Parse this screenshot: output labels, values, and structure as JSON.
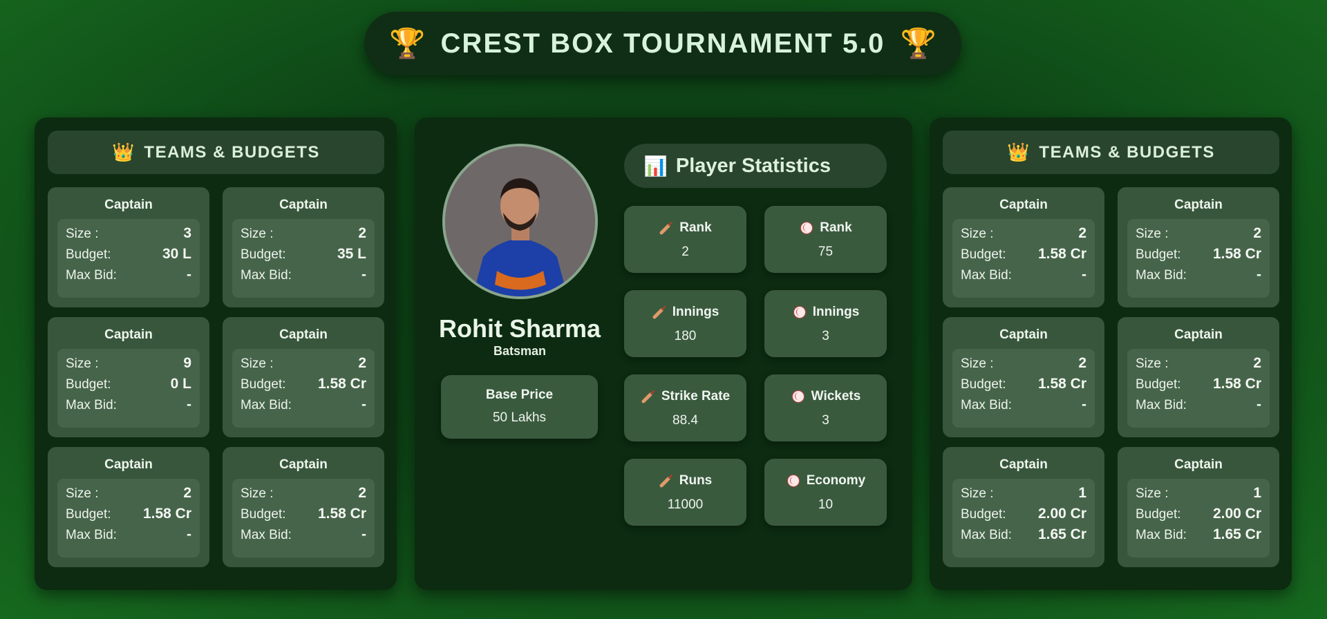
{
  "header": {
    "title": "CREST BOX TOURNAMENT 5.0",
    "icon_left": "🏆",
    "icon_right": "🏆"
  },
  "left_panel": {
    "title": "TEAMS & BUDGETS",
    "icon": "👑",
    "teams": [
      {
        "name": "Captain",
        "size_label": "Size :",
        "size": "3",
        "budget_label": "Budget:",
        "budget": "30 L",
        "maxbid_label": "Max Bid:",
        "maxbid": "-"
      },
      {
        "name": "Captain",
        "size_label": "Size :",
        "size": "2",
        "budget_label": "Budget:",
        "budget": "35 L",
        "maxbid_label": "Max Bid:",
        "maxbid": "-"
      },
      {
        "name": "Captain",
        "size_label": "Size :",
        "size": "9",
        "budget_label": "Budget:",
        "budget": "0 L",
        "maxbid_label": "Max Bid:",
        "maxbid": "-"
      },
      {
        "name": "Captain",
        "size_label": "Size :",
        "size": "2",
        "budget_label": "Budget:",
        "budget": "1.58 Cr",
        "maxbid_label": "Max Bid:",
        "maxbid": "-"
      },
      {
        "name": "Captain",
        "size_label": "Size :",
        "size": "2",
        "budget_label": "Budget:",
        "budget": "1.58 Cr",
        "maxbid_label": "Max Bid:",
        "maxbid": "-"
      },
      {
        "name": "Captain",
        "size_label": "Size :",
        "size": "2",
        "budget_label": "Budget:",
        "budget": "1.58 Cr",
        "maxbid_label": "Max Bid:",
        "maxbid": "-"
      }
    ]
  },
  "right_panel": {
    "title": "TEAMS & BUDGETS",
    "icon": "👑",
    "teams": [
      {
        "name": "Captain",
        "size_label": "Size :",
        "size": "2",
        "budget_label": "Budget:",
        "budget": "1.58 Cr",
        "maxbid_label": "Max Bid:",
        "maxbid": "-"
      },
      {
        "name": "Captain",
        "size_label": "Size :",
        "size": "2",
        "budget_label": "Budget:",
        "budget": "1.58 Cr",
        "maxbid_label": "Max Bid:",
        "maxbid": "-"
      },
      {
        "name": "Captain",
        "size_label": "Size :",
        "size": "2",
        "budget_label": "Budget:",
        "budget": "1.58 Cr",
        "maxbid_label": "Max Bid:",
        "maxbid": "-"
      },
      {
        "name": "Captain",
        "size_label": "Size :",
        "size": "2",
        "budget_label": "Budget:",
        "budget": "1.58 Cr",
        "maxbid_label": "Max Bid:",
        "maxbid": "-"
      },
      {
        "name": "Captain",
        "size_label": "Size :",
        "size": "1",
        "budget_label": "Budget:",
        "budget": "2.00 Cr",
        "maxbid_label": "Max Bid:",
        "maxbid": "1.65 Cr"
      },
      {
        "name": "Captain",
        "size_label": "Size :",
        "size": "1",
        "budget_label": "Budget:",
        "budget": "2.00 Cr",
        "maxbid_label": "Max Bid:",
        "maxbid": "1.65 Cr"
      }
    ]
  },
  "player": {
    "name": "Rohit Sharma",
    "role": "Batsman",
    "photo_icon": "player-photo",
    "base_price_label": "Base Price",
    "base_price": "50 Lakhs"
  },
  "stats": {
    "title": "Player Statistics",
    "icon": "📊",
    "items": [
      {
        "icon": "bat",
        "label": "Rank",
        "value": "2"
      },
      {
        "icon": "ball",
        "label": "Rank",
        "value": "75"
      },
      {
        "icon": "bat",
        "label": "Innings",
        "value": "180"
      },
      {
        "icon": "ball",
        "label": "Innings",
        "value": "3"
      },
      {
        "icon": "bat",
        "label": "Strike Rate",
        "value": "88.4"
      },
      {
        "icon": "ball",
        "label": "Wickets",
        "value": "3"
      },
      {
        "icon": "bat",
        "label": "Runs",
        "value": "11000"
      },
      {
        "icon": "ball",
        "label": "Economy",
        "value": "10"
      }
    ]
  },
  "colors": {
    "background": "#0d4416",
    "panel": "#0c2b10",
    "card": "#38563b",
    "accent_text": "#d9f2dc"
  }
}
